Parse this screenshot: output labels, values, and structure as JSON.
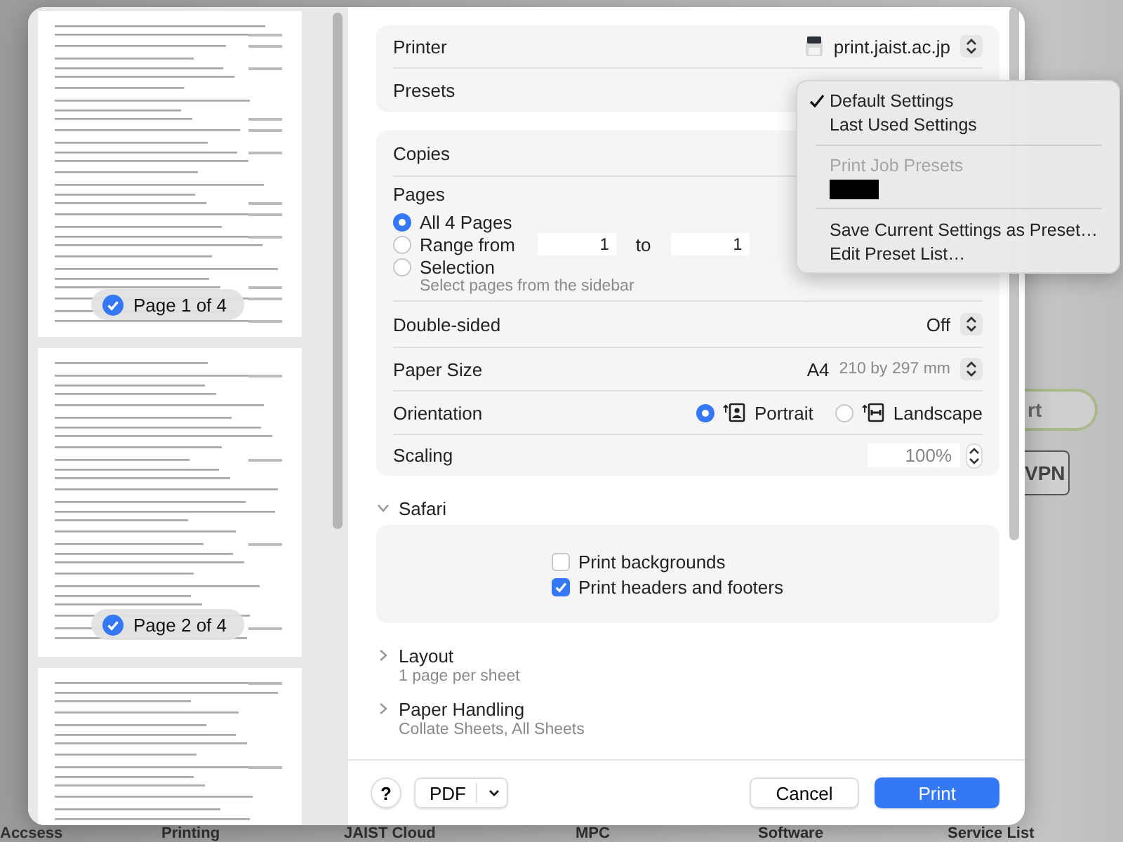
{
  "background_page": {
    "buttons": [
      {
        "kind": "pill",
        "label": "rt"
      },
      {
        "kind": "outlined",
        "label": "VPN"
      }
    ],
    "nav_labels": [
      "Accsess",
      "Printing",
      "JAIST Cloud",
      "MPC",
      "Software",
      "Service List"
    ]
  },
  "sidebar": {
    "pages": [
      {
        "kind": "page",
        "label": "Page 1 of 4",
        "selected": true
      },
      {
        "kind": "page",
        "label": "Page 2 of 4",
        "selected": true
      },
      {
        "kind": "page"
      }
    ]
  },
  "printer": {
    "label": "Printer",
    "value": "print.jaist.ac.jp"
  },
  "presets": {
    "label": "Presets",
    "menu": [
      {
        "kind": "option",
        "label": "Default Settings",
        "selected": true
      },
      {
        "kind": "option",
        "label": "Last Used Settings",
        "selected": false
      },
      {
        "kind": "separator"
      },
      {
        "kind": "header",
        "label": "Print Job Presets"
      },
      {
        "kind": "redacted"
      },
      {
        "kind": "separator"
      },
      {
        "kind": "option",
        "label": "Save Current Settings as Preset…",
        "selected": false
      },
      {
        "kind": "option",
        "label": "Edit Preset List…",
        "selected": false
      }
    ]
  },
  "copies": {
    "label": "Copies"
  },
  "pages": {
    "label": "Pages",
    "options": [
      {
        "kind": "all",
        "label": "All 4 Pages",
        "selected": true
      },
      {
        "kind": "range",
        "label": "Range from",
        "selected": false,
        "from": "1",
        "to_label": "to",
        "to": "1"
      },
      {
        "kind": "selection",
        "label": "Selection",
        "selected": false,
        "hint": "Select pages from the sidebar"
      }
    ]
  },
  "double_sided": {
    "label": "Double-sided",
    "value": "Off"
  },
  "paper_size": {
    "label": "Paper Size",
    "value": "A4",
    "detail": "210 by 297 mm"
  },
  "orientation": {
    "label": "Orientation",
    "options": [
      {
        "kind": "portrait",
        "label": "Portrait",
        "selected": true
      },
      {
        "kind": "landscape",
        "label": "Landscape",
        "selected": false
      }
    ]
  },
  "scaling": {
    "label": "Scaling",
    "value": "100%"
  },
  "sections": [
    {
      "title": "Safari",
      "expanded": true,
      "checkboxes": [
        {
          "label": "Print backgrounds",
          "checked": false
        },
        {
          "label": "Print headers and footers",
          "checked": true
        }
      ]
    },
    {
      "title": "Layout",
      "expanded": false,
      "summary": "1 page per sheet"
    },
    {
      "title": "Paper Handling",
      "expanded": false,
      "summary": "Collate Sheets, All Sheets"
    }
  ],
  "footer": {
    "help": "?",
    "pdf": "PDF",
    "cancel": "Cancel",
    "print": "Print"
  }
}
